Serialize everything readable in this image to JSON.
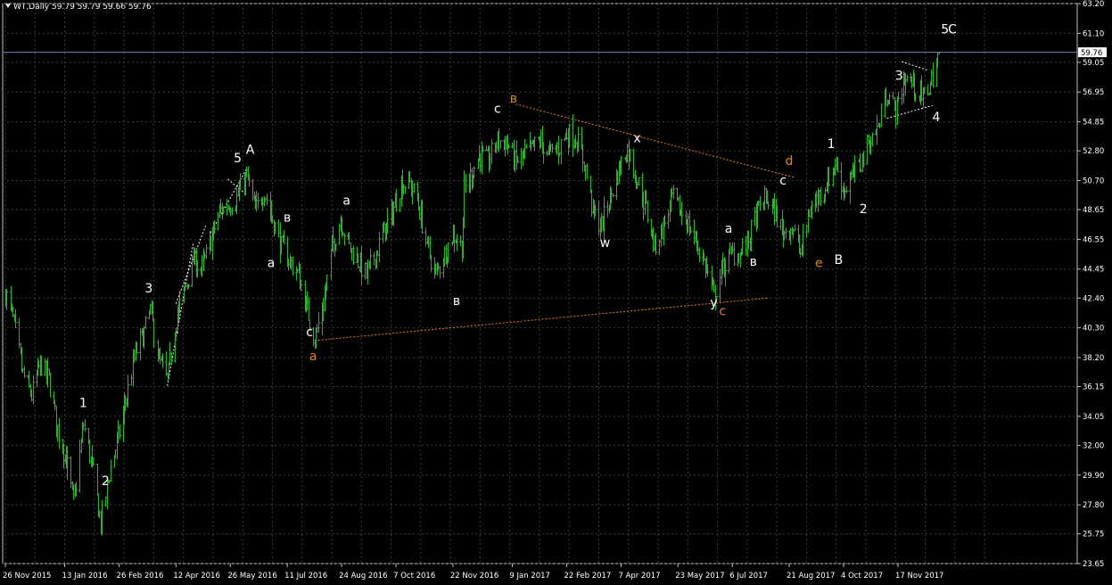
{
  "header": {
    "symbol": "WT,Daily",
    "ohlc": "59.79 59.79 59.66 59.76"
  },
  "colors": {
    "background": "#000000",
    "grid": "#3c3c3c",
    "bars": "#2fb12f",
    "axis_text": "#ffffff",
    "price_line": "#6f7fb8",
    "wave_white": "#ffffff",
    "wave_orange": "#e8820c"
  },
  "chart_data": {
    "type": "ohlc",
    "title": "",
    "grid": true,
    "ylim": [
      23.65,
      63.2
    ],
    "y_ticks": [
      "63.20",
      "61.10",
      "59.05",
      "56.95",
      "54.85",
      "52.80",
      "50.70",
      "48.65",
      "46.55",
      "44.45",
      "42.40",
      "40.30",
      "38.20",
      "36.15",
      "34.05",
      "32.00",
      "29.90",
      "27.80",
      "25.75",
      "23.65"
    ],
    "x_ticks": [
      "26 Nov 2015",
      "13 Jan 2016",
      "26 Feb 2016",
      "12 Apr 2016",
      "26 May 2016",
      "11 Jul 2016",
      "24 Aug 2016",
      "7 Oct 2016",
      "22 Nov 2016",
      "9 Jan 2017",
      "22 Feb 2017",
      "7 Apr 2017",
      "23 May 2017",
      "6 Jul 2017",
      "21 Aug 2017",
      "4 Oct 2017",
      "17 Nov 2017"
    ],
    "x_range": [
      "2015-11-26",
      "2017-12-20"
    ],
    "current_price": "59.76",
    "price_path": [
      [
        "2015-11-26",
        42.8
      ],
      [
        "2015-12-03",
        40.5
      ],
      [
        "2015-12-10",
        37.0
      ],
      [
        "2015-12-17",
        35.5
      ],
      [
        "2015-12-24",
        37.8
      ],
      [
        "2015-12-31",
        36.6
      ],
      [
        "2016-01-07",
        33.2
      ],
      [
        "2016-01-14",
        31.0
      ],
      [
        "2016-01-20",
        27.9
      ],
      [
        "2016-01-28",
        33.5
      ],
      [
        "2016-02-04",
        30.5
      ],
      [
        "2016-02-11",
        26.5
      ],
      [
        "2016-02-18",
        30.0
      ],
      [
        "2016-02-25",
        32.5
      ],
      [
        "2016-03-03",
        35.5
      ],
      [
        "2016-03-10",
        38.5
      ],
      [
        "2016-03-17",
        40.0
      ],
      [
        "2016-03-22",
        41.5
      ],
      [
        "2016-03-29",
        38.0
      ],
      [
        "2016-04-05",
        36.5
      ],
      [
        "2016-04-12",
        41.0
      ],
      [
        "2016-04-19",
        43.0
      ],
      [
        "2016-04-26",
        45.0
      ],
      [
        "2016-05-03",
        44.5
      ],
      [
        "2016-05-10",
        46.5
      ],
      [
        "2016-05-17",
        48.5
      ],
      [
        "2016-05-24",
        49.0
      ],
      [
        "2016-05-31",
        49.5
      ],
      [
        "2016-06-08",
        51.0
      ],
      [
        "2016-06-15",
        48.5
      ],
      [
        "2016-06-22",
        50.0
      ],
      [
        "2016-06-29",
        48.0
      ],
      [
        "2016-07-06",
        46.0
      ],
      [
        "2016-07-13",
        45.0
      ],
      [
        "2016-07-20",
        44.0
      ],
      [
        "2016-07-27",
        41.5
      ],
      [
        "2016-08-02",
        39.5
      ],
      [
        "2016-08-09",
        42.0
      ],
      [
        "2016-08-16",
        46.0
      ],
      [
        "2016-08-23",
        48.0
      ],
      [
        "2016-08-30",
        46.0
      ],
      [
        "2016-09-06",
        45.0
      ],
      [
        "2016-09-13",
        44.0
      ],
      [
        "2016-09-20",
        45.5
      ],
      [
        "2016-09-27",
        47.0
      ],
      [
        "2016-10-04",
        48.5
      ],
      [
        "2016-10-11",
        50.5
      ],
      [
        "2016-10-18",
        50.5
      ],
      [
        "2016-10-25",
        49.0
      ],
      [
        "2016-11-01",
        46.0
      ],
      [
        "2016-11-08",
        44.0
      ],
      [
        "2016-11-15",
        45.5
      ],
      [
        "2016-11-22",
        47.0
      ],
      [
        "2016-11-29",
        46.0
      ],
      [
        "2016-12-01",
        50.0
      ],
      [
        "2016-12-06",
        51.0
      ],
      [
        "2016-12-13",
        52.5
      ],
      [
        "2016-12-20",
        52.0
      ],
      [
        "2016-12-28",
        53.5
      ],
      [
        "2017-01-04",
        53.5
      ],
      [
        "2017-01-11",
        52.0
      ],
      [
        "2017-01-18",
        52.5
      ],
      [
        "2017-01-25",
        53.0
      ],
      [
        "2017-02-01",
        53.5
      ],
      [
        "2017-02-08",
        52.5
      ],
      [
        "2017-02-15",
        53.0
      ],
      [
        "2017-02-22",
        54.0
      ],
      [
        "2017-03-01",
        53.8
      ],
      [
        "2017-03-08",
        52.0
      ],
      [
        "2017-03-15",
        48.5
      ],
      [
        "2017-03-22",
        47.5
      ],
      [
        "2017-03-29",
        49.5
      ],
      [
        "2017-04-05",
        51.5
      ],
      [
        "2017-04-12",
        53.0
      ],
      [
        "2017-04-19",
        51.0
      ],
      [
        "2017-04-26",
        49.0
      ],
      [
        "2017-05-04",
        46.0
      ],
      [
        "2017-05-11",
        47.5
      ],
      [
        "2017-05-18",
        49.5
      ],
      [
        "2017-05-25",
        48.5
      ],
      [
        "2017-06-01",
        47.5
      ],
      [
        "2017-06-08",
        46.0
      ],
      [
        "2017-06-15",
        44.5
      ],
      [
        "2017-06-21",
        42.5
      ],
      [
        "2017-06-28",
        44.5
      ],
      [
        "2017-07-05",
        45.5
      ],
      [
        "2017-07-12",
        45.5
      ],
      [
        "2017-07-19",
        46.5
      ],
      [
        "2017-07-26",
        48.5
      ],
      [
        "2017-08-02",
        49.5
      ],
      [
        "2017-08-09",
        48.5
      ],
      [
        "2017-08-16",
        47.0
      ],
      [
        "2017-08-23",
        47.5
      ],
      [
        "2017-08-30",
        45.5
      ],
      [
        "2017-09-06",
        48.5
      ],
      [
        "2017-09-13",
        49.5
      ],
      [
        "2017-09-20",
        50.5
      ],
      [
        "2017-09-27",
        52.0
      ],
      [
        "2017-10-04",
        50.0
      ],
      [
        "2017-10-11",
        51.0
      ],
      [
        "2017-10-18",
        52.0
      ],
      [
        "2017-10-25",
        53.5
      ],
      [
        "2017-11-01",
        54.5
      ],
      [
        "2017-11-08",
        57.0
      ],
      [
        "2017-11-15",
        55.5
      ],
      [
        "2017-11-22",
        58.0
      ],
      [
        "2017-11-29",
        57.5
      ],
      [
        "2017-12-06",
        56.5
      ],
      [
        "2017-12-13",
        57.5
      ],
      [
        "2017-12-20",
        59.76
      ]
    ],
    "annotations": [
      {
        "text": "1",
        "date": "2016-01-28",
        "price": 34.7,
        "color": "white"
      },
      {
        "text": "2",
        "date": "2016-02-15",
        "price": 29.2,
        "color": "white"
      },
      {
        "text": "3",
        "date": "2016-03-21",
        "price": 42.8,
        "color": "white"
      },
      {
        "text": "5",
        "date": "2016-06-01",
        "price": 52.0,
        "color": "white"
      },
      {
        "text": "A",
        "date": "2016-06-11",
        "price": 52.6,
        "color": "white"
      },
      {
        "text": "в",
        "date": "2016-07-11",
        "price": 47.8,
        "color": "white"
      },
      {
        "text": "a",
        "date": "2016-06-28",
        "price": 44.6,
        "color": "white"
      },
      {
        "text": "c",
        "date": "2016-07-29",
        "price": 39.7,
        "color": "white"
      },
      {
        "text": "a",
        "date": "2016-08-01",
        "price": 38.0,
        "color": "orange"
      },
      {
        "text": "a",
        "date": "2016-08-28",
        "price": 49.0,
        "color": "white"
      },
      {
        "text": "в",
        "date": "2016-11-25",
        "price": 41.9,
        "color": "white"
      },
      {
        "text": "c",
        "date": "2016-12-28",
        "price": 55.5,
        "color": "white"
      },
      {
        "text": "в",
        "date": "2017-01-10",
        "price": 56.2,
        "color": "orange"
      },
      {
        "text": "w",
        "date": "2017-03-25",
        "price": 46.0,
        "color": "white"
      },
      {
        "text": "x",
        "date": "2017-04-20",
        "price": 53.4,
        "color": "white"
      },
      {
        "text": "y",
        "date": "2017-06-21",
        "price": 41.8,
        "color": "white"
      },
      {
        "text": "c",
        "date": "2017-06-28",
        "price": 41.2,
        "color": "orange"
      },
      {
        "text": "a",
        "date": "2017-07-03",
        "price": 47.0,
        "color": "white"
      },
      {
        "text": "в",
        "date": "2017-07-23",
        "price": 44.7,
        "color": "white"
      },
      {
        "text": "c",
        "date": "2017-08-16",
        "price": 50.4,
        "color": "white"
      },
      {
        "text": "d",
        "date": "2017-08-21",
        "price": 51.8,
        "color": "orange"
      },
      {
        "text": "e",
        "date": "2017-09-14",
        "price": 44.6,
        "color": "orange"
      },
      {
        "text": "B",
        "date": "2017-09-30",
        "price": 44.8,
        "color": "white"
      },
      {
        "text": "1",
        "date": "2017-09-24",
        "price": 53.0,
        "color": "white"
      },
      {
        "text": "2",
        "date": "2017-10-20",
        "price": 48.4,
        "color": "white"
      },
      {
        "text": "3",
        "date": "2017-11-18",
        "price": 57.8,
        "color": "white"
      },
      {
        "text": "4",
        "date": "2017-12-18",
        "price": 54.9,
        "color": "white"
      },
      {
        "text": "5",
        "date": "2017-12-25",
        "price": 61.1,
        "color": "white"
      },
      {
        "text": "C",
        "date": "2017-12-31",
        "price": 61.1,
        "color": "white"
      }
    ],
    "wave_lines": [
      {
        "color": "white",
        "points": [
          [
            "2016-04-05",
            36.2
          ],
          [
            "2016-04-26",
            46.3
          ]
        ]
      },
      {
        "color": "white",
        "points": [
          [
            "2016-04-12",
            42.0
          ],
          [
            "2016-05-06",
            47.5
          ]
        ]
      },
      {
        "color": "white",
        "points": [
          [
            "2016-05-10",
            47.0
          ],
          [
            "2016-06-08",
            51.5
          ]
        ]
      },
      {
        "color": "white",
        "points": [
          [
            "2016-05-24",
            50.8
          ],
          [
            "2016-06-08",
            49.7
          ]
        ]
      },
      {
        "color": "orange",
        "points": [
          [
            "2016-08-02",
            39.4
          ],
          [
            "2017-08-04",
            42.4
          ]
        ]
      },
      {
        "color": "orange",
        "points": [
          [
            "2017-01-12",
            56.1
          ],
          [
            "2017-08-26",
            50.9
          ]
        ]
      },
      {
        "color": "white",
        "points": [
          [
            "2017-11-08",
            55.1
          ],
          [
            "2017-12-15",
            56.0
          ]
        ]
      },
      {
        "color": "white",
        "points": [
          [
            "2017-11-20",
            59.1
          ],
          [
            "2017-12-11",
            58.5
          ]
        ]
      }
    ]
  }
}
